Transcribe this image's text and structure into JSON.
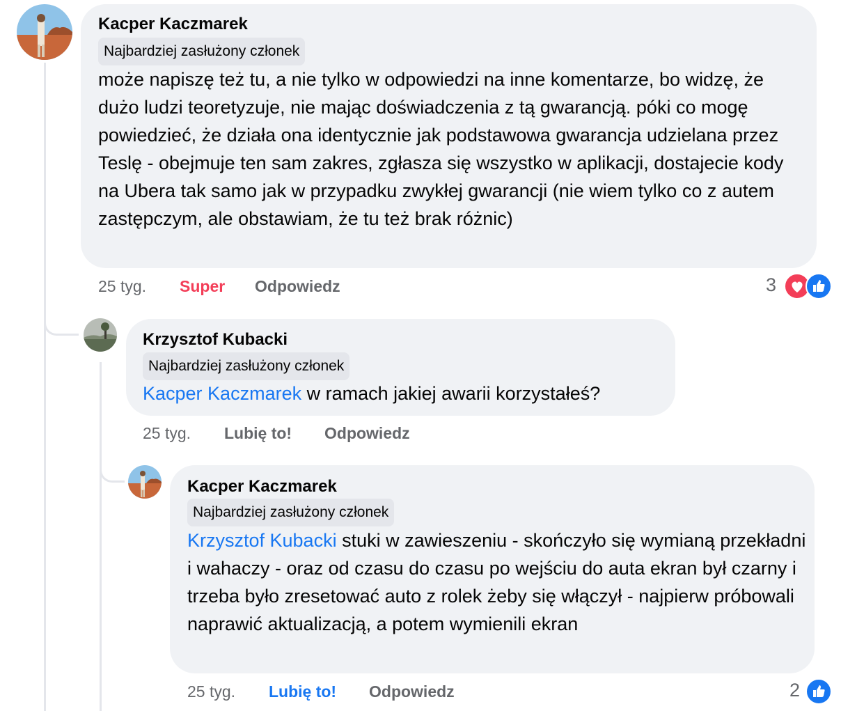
{
  "comments": [
    {
      "author": "Kacper Kaczmarek",
      "badge": "Najbardziej zasłużony członek",
      "text": "może napiszę też tu, a nie tylko w odpowiedzi na inne komentarze, bo widzę, że dużo ludzi teoretyzuje, nie mając doświadczenia z tą gwarancją. póki co mogę powiedzieć, że działa ona identycznie jak podstawowa gwarancja udzielana przez Teslę - obejmuje ten sam zakres, zgłasza się wszystko w aplikacji, dostajecie kody na Ubera tak samo jak w przypadku zwykłej gwarancji (nie wiem tylko co z autem zastępczym, ale obstawiam, że tu też brak różnic)",
      "time": "25 tyg.",
      "reaction_label": "Super",
      "reply_label": "Odpowiedz",
      "reaction_count": "3",
      "reaction_icons": [
        "heart-icon",
        "like-icon"
      ]
    },
    {
      "author": "Krzysztof Kubacki",
      "badge": "Najbardziej zasłużony członek",
      "mention": "Kacper Kaczmarek",
      "text": " w ramach jakiej awarii korzystałeś?",
      "time": "25 tyg.",
      "reaction_label": "Lubię to!",
      "reply_label": "Odpowiedz"
    },
    {
      "author": "Kacper Kaczmarek",
      "badge": "Najbardziej zasłużony członek",
      "mention": "Krzysztof Kubacki",
      "text": " stuki w zawieszeniu - skończyło się wymianą przekładni i wahaczy - oraz od czasu do czasu po wejściu do auta ekran był czarny i trzeba było zresetować auto z rolek żeby się włączył - najpierw próbowali naprawić aktualizacją, a potem wymienili ekran",
      "time": "25 tyg.",
      "reaction_label": "Lubię to!",
      "reply_label": "Odpowiedz",
      "reaction_count": "2",
      "reaction_icons": [
        "like-icon"
      ]
    }
  ],
  "colors": {
    "bubble": "#f0f2f5",
    "badge": "#e4e6eb",
    "link": "#1877f2",
    "love": "#f33e58",
    "muted": "#65676b"
  }
}
